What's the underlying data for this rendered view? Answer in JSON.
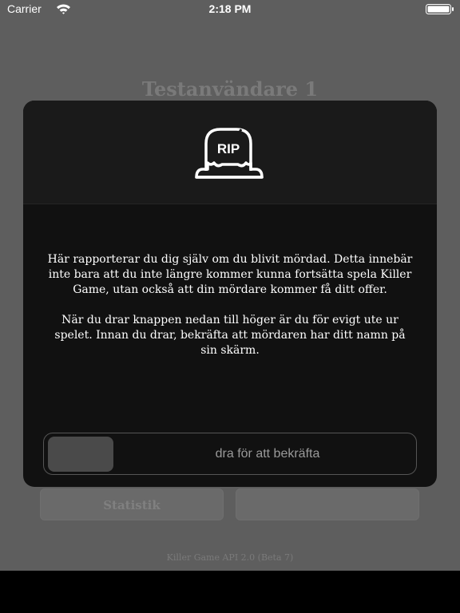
{
  "status_bar": {
    "carrier": "Carrier",
    "time": "2:18 PM",
    "icons": [
      "wifi-icon",
      "battery-icon"
    ]
  },
  "background": {
    "user_name": "Testanvändare 1",
    "stats_button": "Statistik",
    "footer": "Killer Game API 2.0 (Beta 7)"
  },
  "modal": {
    "icon": "rip-icon",
    "icon_text": "RIP",
    "paragraphs": [
      "Här rapporterar du dig själv om du blivit mördad. Detta innebär inte bara att du inte längre kommer kunna fortsätta spela Killer Game, utan också att din mördare kommer få ditt offer.",
      "När du drar knappen nedan till höger är du för evigt ute ur spelet. Innan du drar, bekräfta att mördaren har ditt namn på sin skärm."
    ],
    "slider_label": "dra för att bekräfta"
  },
  "colors": {
    "dim_background": "#5e5e5e",
    "modal_background": "#111111",
    "text": "#ffffff"
  }
}
